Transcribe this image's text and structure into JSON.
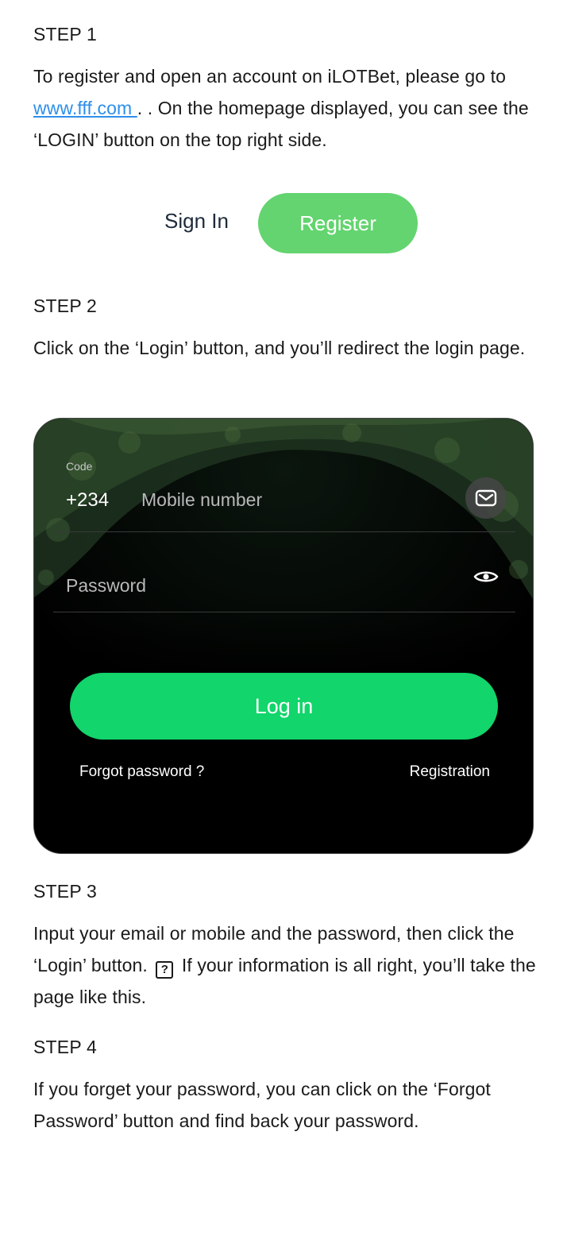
{
  "step1": {
    "label": "STEP 1",
    "text_before": "To register and open an account on iLOTBet, please go to ",
    "link": "www.fff.com ",
    "text_after": ". . On the homepage displayed, you can see the ‘LOGIN’ button on the top right side."
  },
  "header_buttons": {
    "sign_in": "Sign In",
    "register": "Register",
    "register_color": "#63d46f"
  },
  "step2": {
    "label": "STEP 2",
    "text": " Click on the ‘Login’ button, and you’ll redirect the login page."
  },
  "login_card": {
    "code_label": "Code",
    "country_code": "+234",
    "mobile_placeholder": "Mobile number",
    "mail_icon": "mail-icon",
    "password_placeholder": "Password",
    "eye_icon": "eye-icon",
    "login_button": "Log in",
    "login_color": "#12d56b",
    "forgot_password": "Forgot password ?",
    "registration": "Registration"
  },
  "step3": {
    "label": "STEP 3",
    "text_before": " Input your email or mobile and the password, then click the ‘Login’ button. ",
    "broken_image_icon": "?",
    "text_after": " If your information is all right, you’ll take the page like this."
  },
  "step4": {
    "label": "STEP 4",
    "text": " If you forget your password, you can click on the ‘Forgot Password’ button and find back your password."
  }
}
